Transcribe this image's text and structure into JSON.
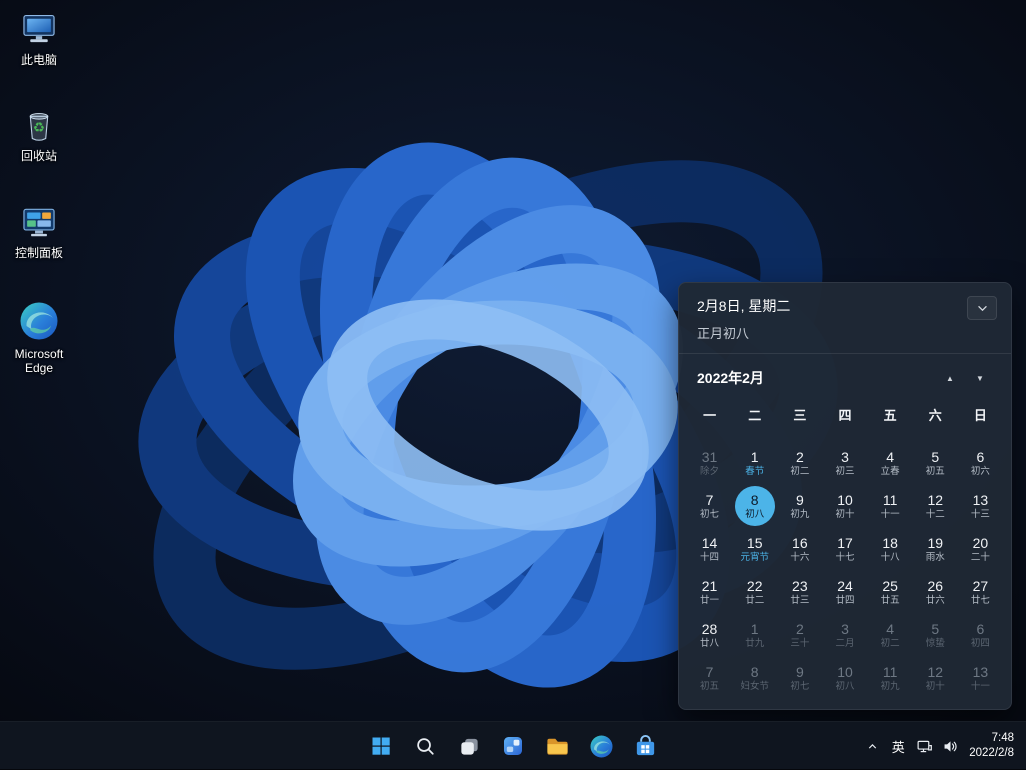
{
  "colors": {
    "accent": "#4cb4e8",
    "taskbar_bg": "#101621",
    "flyout_bg": "#1f2835"
  },
  "desktop_icons": [
    {
      "label": "此电脑"
    },
    {
      "label": "回收站"
    },
    {
      "label": "控制面板"
    },
    {
      "label": "Microsoft Edge"
    }
  ],
  "calendar": {
    "title_date": "2月8日, 星期二",
    "title_lunar": "正月初八",
    "month_label": "2022年2月",
    "weekdays": [
      "一",
      "二",
      "三",
      "四",
      "五",
      "六",
      "日"
    ],
    "days": [
      {
        "num": "31",
        "lunar": "除夕",
        "muted": true
      },
      {
        "num": "1",
        "lunar": "春节",
        "festival": true
      },
      {
        "num": "2",
        "lunar": "初二"
      },
      {
        "num": "3",
        "lunar": "初三"
      },
      {
        "num": "4",
        "lunar": "立春"
      },
      {
        "num": "5",
        "lunar": "初五"
      },
      {
        "num": "6",
        "lunar": "初六"
      },
      {
        "num": "7",
        "lunar": "初七"
      },
      {
        "num": "8",
        "lunar": "初八",
        "selected": true
      },
      {
        "num": "9",
        "lunar": "初九"
      },
      {
        "num": "10",
        "lunar": "初十"
      },
      {
        "num": "11",
        "lunar": "十一"
      },
      {
        "num": "12",
        "lunar": "十二"
      },
      {
        "num": "13",
        "lunar": "十三"
      },
      {
        "num": "14",
        "lunar": "十四"
      },
      {
        "num": "15",
        "lunar": "元宵节",
        "festival": true
      },
      {
        "num": "16",
        "lunar": "十六"
      },
      {
        "num": "17",
        "lunar": "十七"
      },
      {
        "num": "18",
        "lunar": "十八"
      },
      {
        "num": "19",
        "lunar": "雨水"
      },
      {
        "num": "20",
        "lunar": "二十"
      },
      {
        "num": "21",
        "lunar": "廿一"
      },
      {
        "num": "22",
        "lunar": "廿二"
      },
      {
        "num": "23",
        "lunar": "廿三"
      },
      {
        "num": "24",
        "lunar": "廿四"
      },
      {
        "num": "25",
        "lunar": "廿五"
      },
      {
        "num": "26",
        "lunar": "廿六"
      },
      {
        "num": "27",
        "lunar": "廿七"
      },
      {
        "num": "28",
        "lunar": "廿八"
      },
      {
        "num": "1",
        "lunar": "廿九",
        "muted": true
      },
      {
        "num": "2",
        "lunar": "三十",
        "muted": true
      },
      {
        "num": "3",
        "lunar": "二月",
        "muted": true
      },
      {
        "num": "4",
        "lunar": "初二",
        "muted": true
      },
      {
        "num": "5",
        "lunar": "惊蛰",
        "muted": true
      },
      {
        "num": "6",
        "lunar": "初四",
        "muted": true
      },
      {
        "num": "7",
        "lunar": "初五",
        "muted": true
      },
      {
        "num": "8",
        "lunar": "妇女节",
        "muted": true
      },
      {
        "num": "9",
        "lunar": "初七",
        "muted": true
      },
      {
        "num": "10",
        "lunar": "初八",
        "muted": true
      },
      {
        "num": "11",
        "lunar": "初九",
        "muted": true
      },
      {
        "num": "12",
        "lunar": "初十",
        "muted": true
      },
      {
        "num": "13",
        "lunar": "十一",
        "muted": true
      }
    ]
  },
  "taskbar": {
    "icons": [
      "start",
      "search",
      "task-view",
      "widgets",
      "file-explorer",
      "edge",
      "store"
    ]
  },
  "tray": {
    "ime_label": "英",
    "time": "7:48",
    "date": "2022/2/8"
  }
}
